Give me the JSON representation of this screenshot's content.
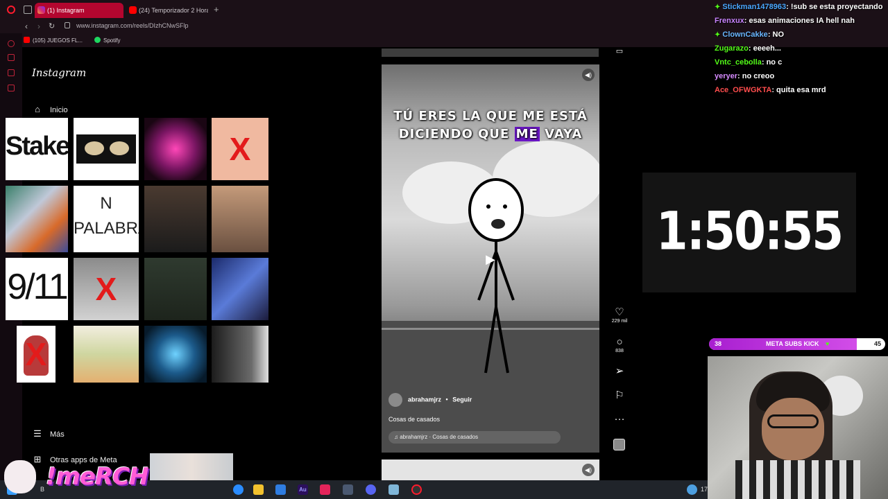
{
  "browser": {
    "tabs": [
      {
        "label": "(1) Instagram"
      },
      {
        "label": "(24) Temporizador 2 Hora"
      }
    ],
    "new_tab_symbol": "+",
    "url": "www.instagram.com/reels/DIzhCNwSFlp",
    "bookmarks": [
      {
        "label": "(105) JUEGOS FL..."
      },
      {
        "label": "Spotify"
      }
    ]
  },
  "instagram": {
    "brand": "Instagram",
    "nav": {
      "home": "Inicio",
      "more": "Más",
      "meta_apps": "Otras apps de Meta"
    },
    "reel": {
      "caption_line1": "TÚ ERES LA QUE ME ESTÁ",
      "caption_pre": "DICIENDO QUE ",
      "caption_highlight": "ME",
      "caption_post": " VAYA",
      "author": "abrahamjrz",
      "separator": "•",
      "follow_label": "Seguir",
      "description": "Cosas de casados",
      "audio": "abrahamjrz · Cosas de casados"
    },
    "actions": {
      "likes": "229 mil",
      "comments": "838"
    }
  },
  "overlay_grid": {
    "tiles": [
      {
        "text": "Stake"
      },
      {
        "text": ""
      },
      {
        "text": ""
      },
      {
        "text": ""
      },
      {
        "text": ""
      },
      {
        "text_line1": "N",
        "text_line2": "PALABRA"
      },
      {
        "text": ""
      },
      {
        "text": ""
      },
      {
        "text": "9/11"
      },
      {
        "text": ""
      },
      {
        "text": ""
      },
      {
        "text": ""
      },
      {
        "text": ""
      },
      {
        "text": ""
      },
      {
        "text": ""
      },
      {
        "text": ""
      }
    ],
    "x_mark": "X"
  },
  "timer": {
    "value": "1:50:55"
  },
  "chat": {
    "messages": [
      {
        "user": "Stickman1478963",
        "text": ": !sub se esta proyectando",
        "color": "#4aa8ff",
        "badge": true
      },
      {
        "user": "Frenxux",
        "text": ": esas animaciones IA hell nah",
        "color": "#c884ff",
        "badge": false
      },
      {
        "user": "ClownCakke",
        "text": ": NO",
        "color": "#6ab6ff",
        "badge": true
      },
      {
        "user": "Zugarazo",
        "text": ": eeeeh...",
        "color": "#53fc18",
        "badge": false
      },
      {
        "user": "Vntc_cebolla",
        "text": ": no c",
        "color": "#53fc18",
        "badge": false
      },
      {
        "user": "yeryer",
        "text": ": no creoo",
        "color": "#d78bff",
        "badge": false
      },
      {
        "user": "Ace_OFWGKTA",
        "text": ": quita esa mrd",
        "color": "#ff4d4d",
        "badge": false
      }
    ]
  },
  "sub_goal": {
    "current": "38",
    "label": "META SUBS KICK",
    "heart": "♥",
    "target": "45",
    "progress_fraction": 0.84
  },
  "merch": {
    "text": "!meRCH"
  },
  "taskbar": {
    "search_fragment": "B",
    "au_label": "Au",
    "clock_fragment": "17"
  },
  "colors": {
    "opera_red": "#ff1b2d",
    "active_tab": "#b3062f",
    "highlight_purple": "#6b16c7",
    "kick_green": "#53fc18"
  }
}
